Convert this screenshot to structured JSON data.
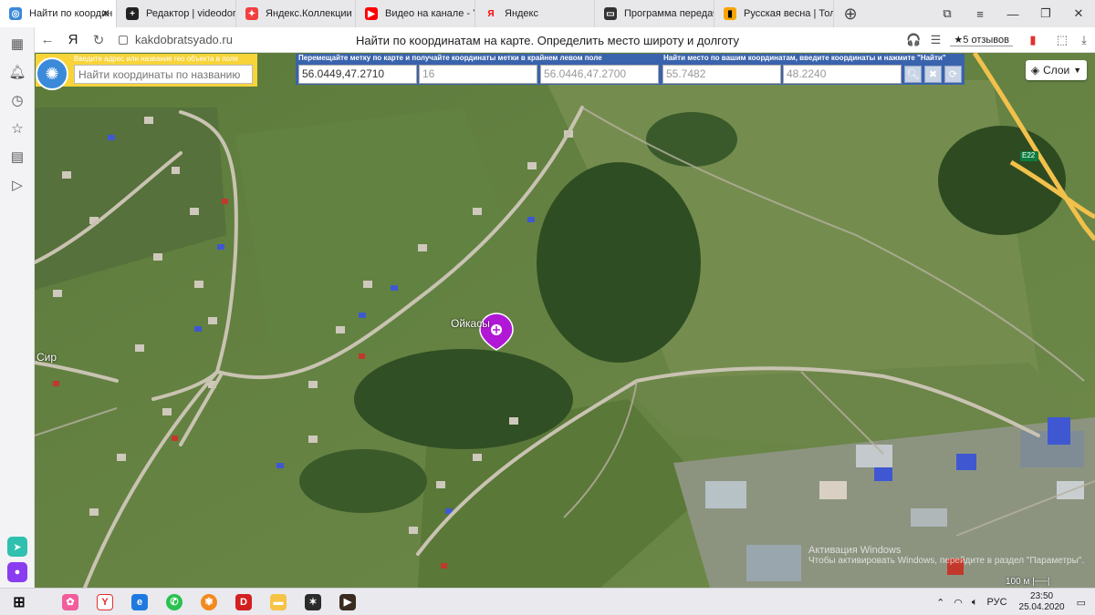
{
  "tabs": [
    {
      "label": "Найти по координ",
      "color": "#3b8ad9",
      "glyph": "◎",
      "active": true
    },
    {
      "label": "Редактор | videodoro",
      "color": "#222222",
      "glyph": "+"
    },
    {
      "label": "Яндекс.Коллекции",
      "color": "#f04040",
      "glyph": "✦"
    },
    {
      "label": "Видео на канале - Yo",
      "color": "#ff0000",
      "glyph": "▶"
    },
    {
      "label": "Яндекс",
      "color": "#ffffff",
      "glyph": "Я"
    },
    {
      "label": "Программа передач",
      "color": "#333333",
      "glyph": "▭"
    },
    {
      "label": "Русская весна | Толь",
      "color": "#f7a500",
      "glyph": "▮"
    }
  ],
  "address": {
    "domain": "kakdobratsyado.ru",
    "title": "Найти по координатам на карте. Определить место широту и долготу",
    "reviews": "★5 отзывов"
  },
  "search": {
    "header": "Введите адрес или название гео объекта в поле",
    "placeholder": "Найти координаты по названию"
  },
  "coords": {
    "header_left": "Перемещайте метку по карте и получайте координаты метки в крайнем левом поле",
    "header_right": "Найти место по вашим координатам, введите координаты и нажмите \"Найти\"",
    "marker_coords": "56.0449,47.2710",
    "zoom": "16",
    "center_coords": "56.0446,47.2700",
    "lat_input": "55.7482",
    "lon_input": "48.2240"
  },
  "map": {
    "layers_label": "Слои",
    "place_label": "Ойкасы",
    "left_label": "Сир",
    "road_badge": "E22",
    "scale": "100 м",
    "watermark_1": "Активация Windows",
    "watermark_2": "Чтобы активировать Windows, перейдите в раздел \"Параметры\"."
  },
  "taskbar": {
    "lang": "РУС",
    "time": "23:50",
    "date": "25.04.2020"
  }
}
